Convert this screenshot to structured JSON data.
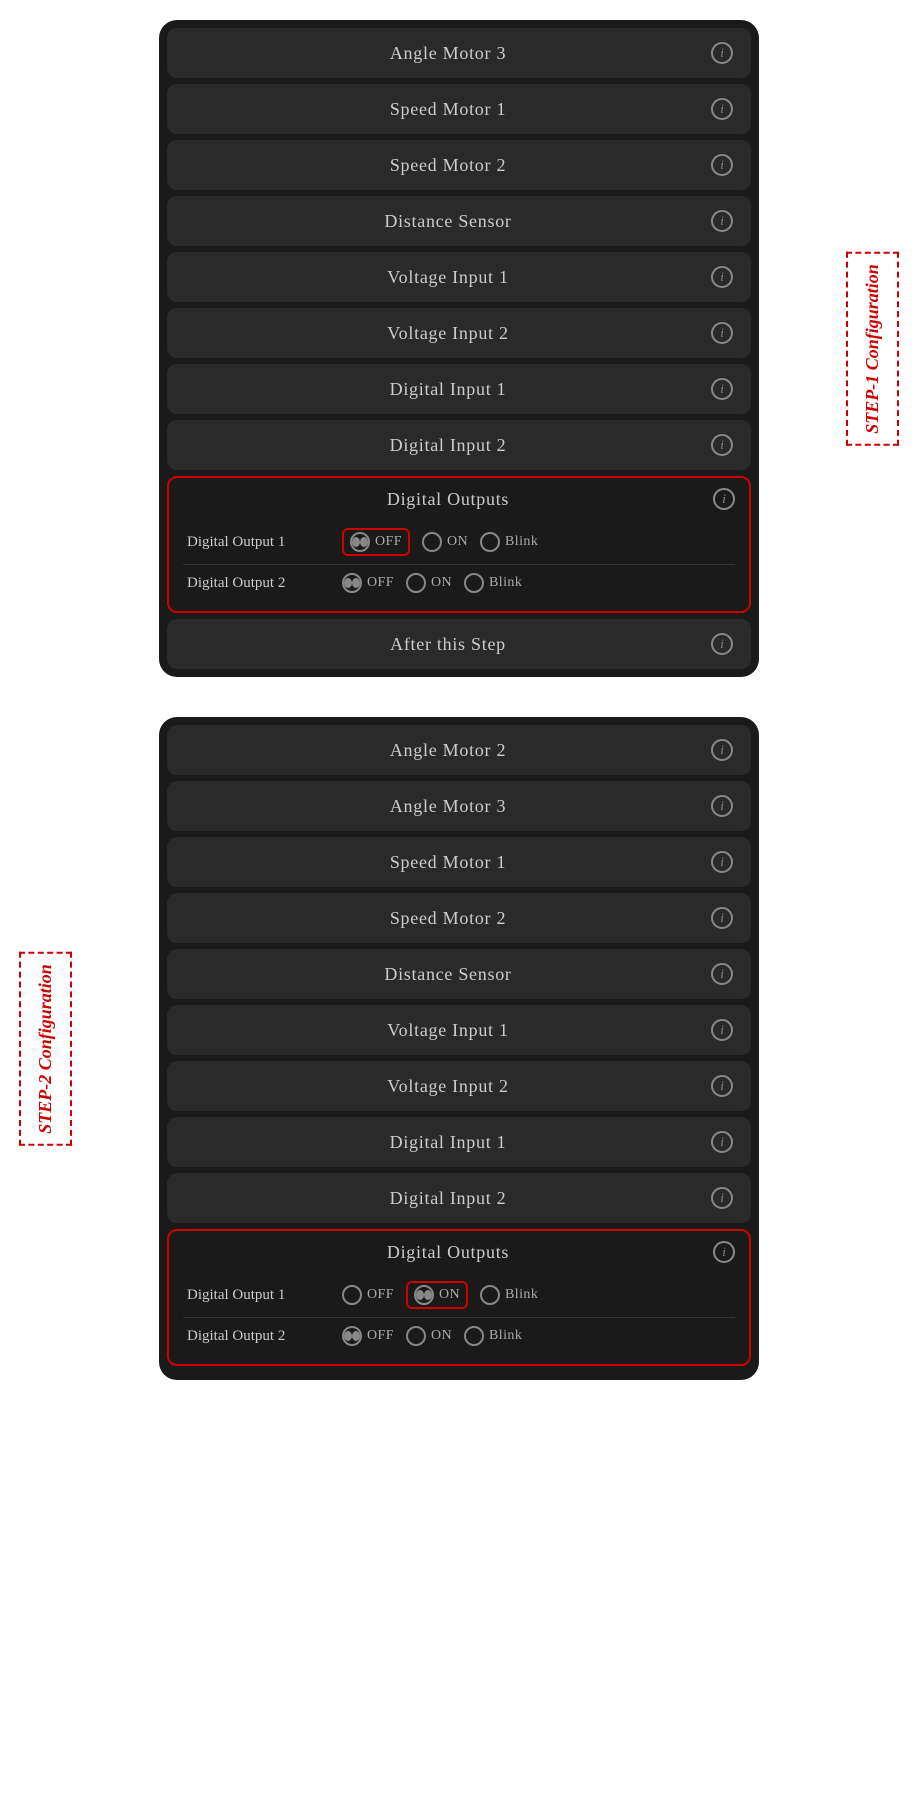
{
  "panel1": {
    "rows": [
      {
        "label": "Angle Motor 3"
      },
      {
        "label": "Speed Motor 1"
      },
      {
        "label": "Speed Motor 2"
      },
      {
        "label": "Distance Sensor"
      },
      {
        "label": "Voltage Input 1"
      },
      {
        "label": "Voltage Input 2"
      },
      {
        "label": "Digital Input 1"
      },
      {
        "label": "Digital Input 2"
      }
    ],
    "digital_outputs": {
      "title": "Digital Outputs",
      "output1": {
        "label": "Digital Output 1",
        "options": [
          "OFF",
          "ON",
          "Blink"
        ],
        "selected": "OFF",
        "highlighted": "OFF"
      },
      "output2": {
        "label": "Digital Output 2",
        "options": [
          "OFF",
          "ON",
          "Blink"
        ],
        "selected": "OFF"
      }
    },
    "after_step": "After this Step",
    "step_label": "STEP-1 Configuration"
  },
  "panel2": {
    "rows": [
      {
        "label": "Angle Motor 2"
      },
      {
        "label": "Angle Motor 3"
      },
      {
        "label": "Speed Motor 1"
      },
      {
        "label": "Speed Motor 2"
      },
      {
        "label": "Distance Sensor"
      },
      {
        "label": "Voltage Input 1"
      },
      {
        "label": "Voltage Input 2"
      },
      {
        "label": "Digital Input 1"
      },
      {
        "label": "Digital Input 2"
      }
    ],
    "digital_outputs": {
      "title": "Digital Outputs",
      "output1": {
        "label": "Digital Output 1",
        "options": [
          "OFF",
          "ON",
          "Blink"
        ],
        "selected": "ON",
        "highlighted": "ON"
      },
      "output2": {
        "label": "Digital Output 2",
        "options": [
          "OFF",
          "ON",
          "Blink"
        ],
        "selected": "OFF"
      }
    },
    "step_label": "STEP-2 Configuration"
  },
  "info_icon_label": "i"
}
